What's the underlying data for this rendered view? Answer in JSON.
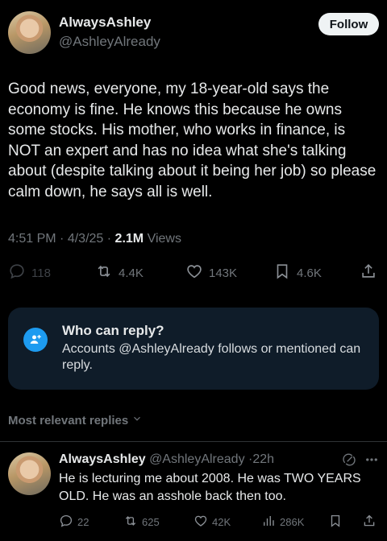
{
  "author": {
    "name": "AlwaysAshley",
    "handle": "@AshleyAlready",
    "follow_label": "Follow"
  },
  "tweet": {
    "text": "Good news, everyone, my 18-year-old says the economy is fine. He knows this because he owns some stocks. His mother, who works in finance, is NOT an expert and has no idea what she's talking about (despite talking about it being her job) so please calm down, he says all is well.",
    "time": "4:51 PM",
    "date": "4/3/25",
    "views_count": "2.1M",
    "views_label": "Views"
  },
  "stats": {
    "replies": "118",
    "retweets": "4.4K",
    "likes": "143K",
    "bookmarks": "4.6K"
  },
  "who_can_reply": {
    "title": "Who can reply?",
    "description": "Accounts @AshleyAlready follows or mentioned can reply."
  },
  "sort_label": "Most relevant replies",
  "reply": {
    "name": "AlwaysAshley",
    "handle": "@AshleyAlready",
    "age": "22h",
    "text": "He is lecturing me about 2008. He was TWO YEARS OLD. He was an asshole back then too.",
    "replies": "22",
    "retweets": "625",
    "likes": "42K",
    "views": "286K"
  },
  "icons": {
    "reply": "reply-bubble-icon",
    "retweet": "retweet-icon",
    "like": "heart-icon",
    "bookmark": "bookmark-icon",
    "share": "share-icon",
    "views": "views-bar-icon",
    "grok": "grok-icon",
    "more": "more-icon"
  },
  "colors": {
    "background": "#000000",
    "accent": "#1d9bf0",
    "muted": "#71767b",
    "reply_box": "#0f1c29"
  }
}
